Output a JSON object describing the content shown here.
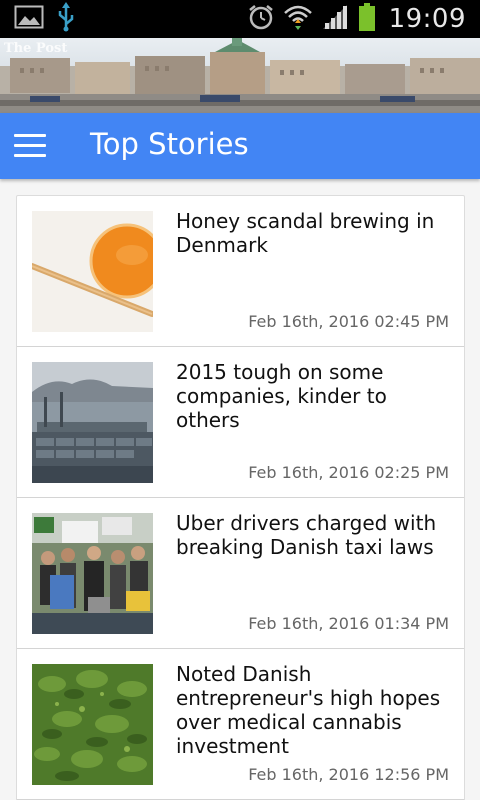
{
  "status_bar": {
    "time": "19:09",
    "icons": [
      "image-icon",
      "usb-icon",
      "alarm-icon",
      "wifi-icon",
      "signal-icon",
      "battery-icon"
    ]
  },
  "banner": {
    "description_icon": "city-banner-image"
  },
  "app_bar": {
    "title": "Top Stories",
    "menu_icon": "hamburger-menu-icon",
    "color": "#4285f4"
  },
  "stories": [
    {
      "headline": "Honey scandal brewing in Denmark",
      "date": "Feb 16th, 2016 02:45 PM",
      "thumb_icon": "honey-jar-image"
    },
    {
      "headline": "2015 tough on some companies, kinder to others",
      "date": "Feb 16th, 2016 02:25 PM",
      "thumb_icon": "container-port-image"
    },
    {
      "headline": "Uber drivers charged with breaking Danish taxi laws",
      "date": "Feb 16th, 2016 01:34 PM",
      "thumb_icon": "protest-crowd-image"
    },
    {
      "headline": "Noted Danish entrepreneur's high hopes over medical cannabis investment",
      "date": "Feb 16th, 2016 12:56 PM",
      "thumb_icon": "cannabis-plants-image"
    }
  ]
}
